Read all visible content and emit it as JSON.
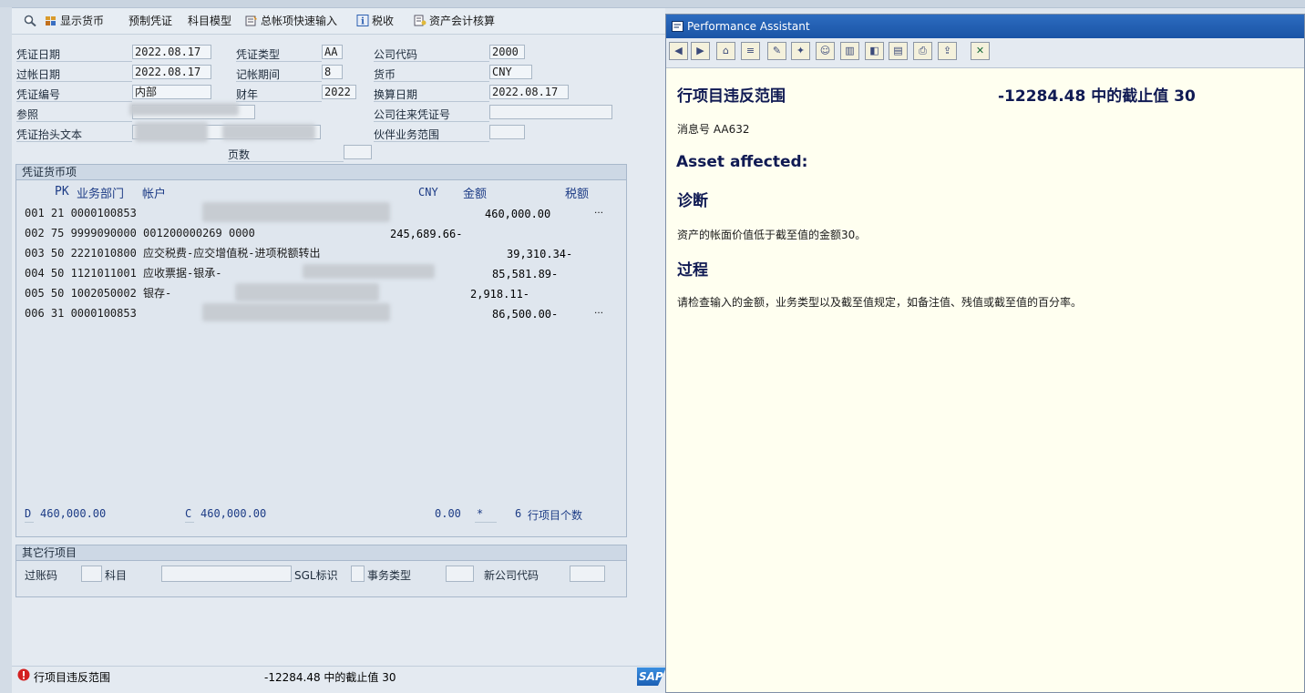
{
  "toolbar": {
    "items": [
      {
        "label": "显示货币",
        "icon": "magnify-currency-icon"
      },
      {
        "label": "预制凭证"
      },
      {
        "label": "科目模型"
      },
      {
        "label": "总帐项快速输入",
        "icon": "fast-entry-icon"
      },
      {
        "label": "税收",
        "icon": "info-icon"
      },
      {
        "label": "资产会计核算",
        "icon": "asset-accounting-icon"
      }
    ]
  },
  "header": {
    "doc_date_label": "凭证日期",
    "doc_date": "2022.08.17",
    "post_date_label": "过帐日期",
    "post_date": "2022.08.17",
    "doc_no_label": "凭证编号",
    "doc_no": "内部",
    "reference_label": "参照",
    "header_text_label": "凭证抬头文本",
    "doc_type_label": "凭证类型",
    "doc_type": "AA",
    "period_label": "记帐期间",
    "period": "8",
    "fiscal_year_label": "财年",
    "fiscal_year": "2022",
    "page_label": "页数",
    "company_code_label": "公司代码",
    "company_code": "2000",
    "currency_label": "货币",
    "currency": "CNY",
    "translation_date_label": "换算日期",
    "translation_date": "2022.08.17",
    "intercompany_label": "公司往来凭证号",
    "trading_partner_label": "伙伴业务范围"
  },
  "items_group": {
    "title": "凭证货币项",
    "col_pk": "PK",
    "col_business_area": "业务部门",
    "col_account": "帐户",
    "col_currency": "CNY",
    "col_amount": "金额",
    "col_tax": "税额",
    "rows": [
      {
        "text": "001 21       0000100853",
        "amount": "460,000.00",
        "more": "…"
      },
      {
        "text": "002 75       9999090000 001200000269 0000",
        "amount": "245,689.66-"
      },
      {
        "text": "003 50       2221010800 应交税费-应交增值税-进项税额转出",
        "amount": "39,310.34-"
      },
      {
        "text": "004 50       1121011001 应收票据-银承-",
        "amount": "85,581.89-"
      },
      {
        "text": "005 50       1002050002 银存-",
        "amount": "2,918.11-"
      },
      {
        "text": "006 31       0000100853",
        "amount": "86,500.00-",
        "more": "…"
      }
    ],
    "debit_label": "D",
    "debit_total": "460,000.00",
    "credit_label": "C",
    "credit_total": "460,000.00",
    "balance": "0.00",
    "balance_flag": "*",
    "line_count": "6",
    "line_count_label": "行项目个数"
  },
  "other_group": {
    "title": "其它行项目",
    "posting_key_label": "过账码",
    "account_label": "科目",
    "sgl_label": "SGL标识",
    "trans_type_label": "事务类型",
    "new_company_label": "新公司代码"
  },
  "status_bar": {
    "message_left": "行项目违反范围",
    "message_right": "-12284.48 中的截止值 30",
    "logo": "SAP"
  },
  "pa": {
    "window_title": "Performance Assistant",
    "heading_left": "行项目违反范围",
    "heading_right": "-12284.48 中的截止值  30",
    "msg_no": "消息号  AA632",
    "asset_affected": "Asset affected:",
    "diag_title": "诊断",
    "diag_text": "资产的帐面价值低于截至值的金额30。",
    "proc_title": "过程",
    "proc_text": "请检查输入的金额，业务类型以及截至值规定，如备注值、残值或截至值的百分率。"
  }
}
